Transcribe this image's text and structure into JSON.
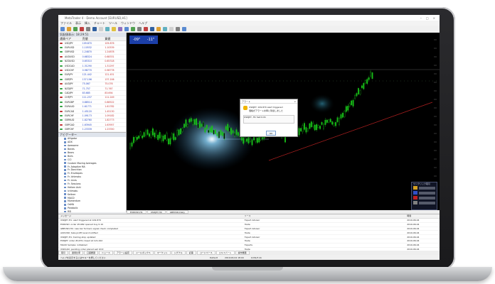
{
  "window": {
    "title": "MetaTrader 4 - Demo Account [EURUSD,H1]"
  },
  "menu": [
    "ファイル",
    "表示",
    "挿入",
    "チャート",
    "ツール",
    "ウィンドウ",
    "ヘルプ"
  ],
  "market_watch": {
    "title": "気配値表示: 18:29:51",
    "columns": [
      "通貨ペア",
      "売値",
      "買値"
    ],
    "rows": [
      {
        "sym": "USDJPY",
        "bid": "109.870",
        "ask": "109.876"
      },
      {
        "sym": "EURUSD",
        "bid": "1.10532",
        "ask": "1.10539"
      },
      {
        "sym": "GBPUSD",
        "bid": "1.24870",
        "ask": "1.24878"
      },
      {
        "sym": "AUDUSD",
        "bid": "0.68324",
        "ask": "0.68331"
      },
      {
        "sym": "NZDUSD",
        "bid": "0.65310",
        "ask": "0.65318"
      },
      {
        "sym": "USDCAD",
        "bid": "1.31290",
        "ask": "1.31297"
      },
      {
        "sym": "USDCHF",
        "bid": "0.98770",
        "ask": "0.98778"
      },
      {
        "sym": "EURJPY",
        "bid": "121.442",
        "ask": "121.451"
      },
      {
        "sym": "GBPJPY",
        "bid": "137.196",
        "ask": "137.206"
      },
      {
        "sym": "AUDJPY",
        "bid": "75.067",
        "ask": "75.076"
      },
      {
        "sym": "NZDJPY",
        "bid": "71.757",
        "ask": "71.767"
      },
      {
        "sym": "CADJPY",
        "bid": "83.685",
        "ask": "83.694"
      },
      {
        "sym": "CHFJPY",
        "bid": "111.237",
        "ask": "111.249"
      },
      {
        "sym": "EURGBP",
        "bid": "0.88514",
        "ask": "0.88522"
      },
      {
        "sym": "EURAUD",
        "bid": "1.61771",
        "ask": "1.61782"
      },
      {
        "sym": "EURCAD",
        "bid": "1.45120",
        "ask": "1.45130"
      },
      {
        "sym": "EURCHF",
        "bid": "1.09173",
        "ask": "1.09182"
      },
      {
        "sym": "GBPAUD",
        "bid": "1.82760",
        "ask": "1.82773"
      },
      {
        "sym": "GBPCAD",
        "bid": "1.63945",
        "ask": "1.63957"
      },
      {
        "sym": "GBPCHF",
        "bid": "1.23339",
        "ask": "1.23350"
      },
      {
        "sym": "AUDCAD",
        "bid": "0.89706",
        "ask": "0.89715"
      },
      {
        "sym": "AUDNZD",
        "bid": "1.04616",
        "ask": "1.04626"
      }
    ],
    "tabs": [
      "通貨ペアリスト",
      "ティックチャート"
    ]
  },
  "navigator": {
    "title": "ナビゲーター",
    "items": [
      "Alligator",
      "ADX",
      "Awesome",
      "Bands",
      "Bears",
      "Bulls",
      "CCI",
      "Custom Moving Averages",
      "Fr. Adaptive MA",
      "Fr. Donchian",
      "Fr. Envelopes",
      "Fr. Ichimoku",
      "Fr. Lines",
      "Fr. Sessions",
      "Heiken Ashi",
      "Ichimoku",
      "Keltner",
      "MACD",
      "Momentum",
      "OsMA",
      "Parabolic",
      "RSI",
      "Stochastic",
      "ZigZag",
      "エキスパートアドバイザ",
      "MACD Sample",
      "Moving Average",
      "スクリプト",
      "PeriodConverter"
    ]
  },
  "chart": {
    "badge_left": "-09\"",
    "badge_right": "-11\"",
    "tabs": [
      "EURUSD,H1",
      "USDJPY,H4",
      "GBPUSD,Daily"
    ],
    "tf_panel_title": "ワンクリック取引"
  },
  "dialog": {
    "title": "アラート",
    "line1": "USDJPY: 109.870 alert triggered",
    "line2": "価格がアラート水準に到達しました",
    "line3": "USDJPY, H1    Sell 0.01",
    "ok": "OK"
  },
  "terminal": {
    "columns": [
      "メッセージ",
      "ソース",
      "時間"
    ],
    "rows": [
      {
        "msg": "USDJPY,H1: alert triggered at 109.870",
        "src": "Expert Advisor",
        "time": "2019.06.04"
      },
      {
        "msg": "EURUSD: order #1482 opened buy 0.10",
        "src": "Trade",
        "time": "2019.06.04"
      },
      {
        "msg": "GBPUSD,H4: new bar formed, signal check completed",
        "src": "Expert Advisor",
        "time": "2019.06.04"
      },
      {
        "msg": "AUDUSD: take profit level modified",
        "src": "Trade",
        "time": "2019.06.04"
      },
      {
        "msg": "USDJPY,H1: trailing stop updated",
        "src": "Expert Advisor",
        "time": "2019.06.04"
      },
      {
        "msg": "EURJPY: order #1479 closed at 121.442",
        "src": "Trade",
        "time": "2019.06.04"
      },
      {
        "msg": "MACD Sample: initialized",
        "src": "Experts",
        "time": "2019.06.04"
      },
      {
        "msg": "USDCAD: pending order placed sell limit",
        "src": "Trade",
        "time": "2019.06.04"
      },
      {
        "msg": "NZDUSD,H1: alert condition met",
        "src": "Expert Advisor",
        "time": "2019.06.04"
      },
      {
        "msg": "connection to server restored",
        "src": "Journal",
        "time": "2019.06.04"
      },
      {
        "msg": "GBPJPY: stop loss modified",
        "src": "Trade",
        "time": "2019.06.04"
      }
    ],
    "tabs": [
      "取引",
      "運用比率",
      "口座履歴",
      "ニュース",
      "アラーム設定",
      "メールボックス",
      "マーケット",
      "シグナル",
      "記事",
      "コードベース",
      "エキスパート",
      "操作履歴"
    ],
    "active_tab": 10
  },
  "status": {
    "help": "ヘルプを表示するにはF1キーを押してください",
    "profile": "Default",
    "datetime": "2019.06.04 18:00",
    "traffic": "1032/3 kb"
  },
  "colors": {
    "chart_bg": "#000000",
    "candle": "#18c018",
    "badge": "#1c3fa8",
    "trend": "#c02020"
  }
}
